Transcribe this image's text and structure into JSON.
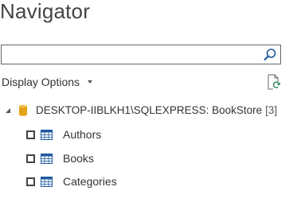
{
  "window": {
    "title": "Navigator"
  },
  "search": {
    "value": "",
    "placeholder": ""
  },
  "toolbar": {
    "display_options_label": "Display Options"
  },
  "tree": {
    "root": {
      "label": "DESKTOP-IIBLKH1\\SQLEXPRESS: BookStore",
      "count": "[3]",
      "expanded": true
    },
    "items": [
      {
        "label": "Authors",
        "checked": false
      },
      {
        "label": "Books",
        "checked": false
      },
      {
        "label": "Categories",
        "checked": false
      }
    ]
  },
  "colors": {
    "accent_blue": "#1e5a9e",
    "database_gold": "#e3a21a",
    "text": "#333333",
    "border": "#666666"
  },
  "icons": {
    "search": "search-icon",
    "refresh": "refresh-icon",
    "expand": "expand-triangle-icon",
    "database": "database-icon",
    "table": "table-icon"
  }
}
